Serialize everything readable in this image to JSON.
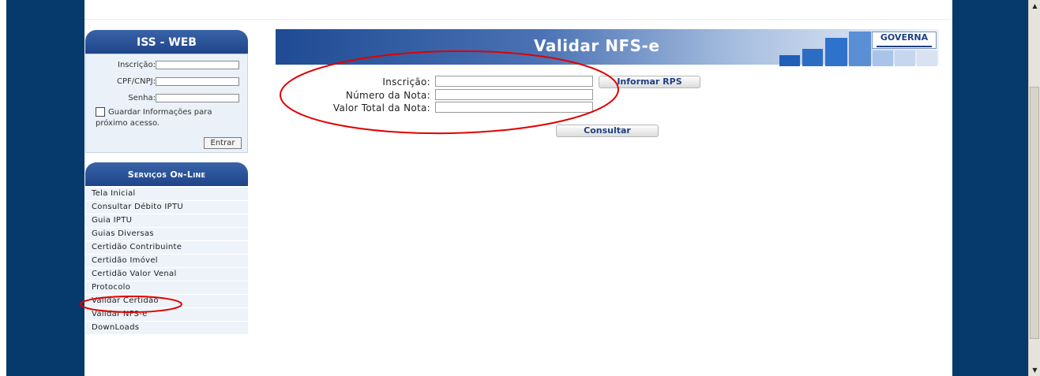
{
  "login": {
    "title": "ISS - WEB",
    "inscricao_label": "Inscrição:",
    "cpf_label": "CPF/CNPJ:",
    "senha_label": "Senha:",
    "remember_label": "Guardar Informações para próximo acesso.",
    "submit_label": "Entrar"
  },
  "services": {
    "title": "Serviços On-Line",
    "items": [
      {
        "label": "Tela Inicial"
      },
      {
        "label": "Consultar Débito IPTU"
      },
      {
        "label": "Guia IPTU"
      },
      {
        "label": "Guias Diversas"
      },
      {
        "label": "Certidão Contribuinte"
      },
      {
        "label": "Certidão Imóvel"
      },
      {
        "label": "Certidão Valor Venal"
      },
      {
        "label": "Protocolo"
      },
      {
        "label": "Validar Certidão"
      },
      {
        "label": "Validar NFS-e"
      },
      {
        "label": "DownLoads"
      }
    ]
  },
  "banner": {
    "title": "Validar NFS-e",
    "logo_text": "GOVERNA"
  },
  "form": {
    "inscricao_label": "Inscrição:",
    "numero_label": "Número da Nota:",
    "valor_label": "Valor Total da Nota:",
    "inscricao_value": "",
    "numero_value": "",
    "valor_value": "",
    "informar_rps_label": "Informar RPS",
    "consultar_label": "Consultar"
  },
  "colors": {
    "page_background": "#06396c",
    "banner_dark": "#1f4b94",
    "annotation_red": "#e10000"
  }
}
